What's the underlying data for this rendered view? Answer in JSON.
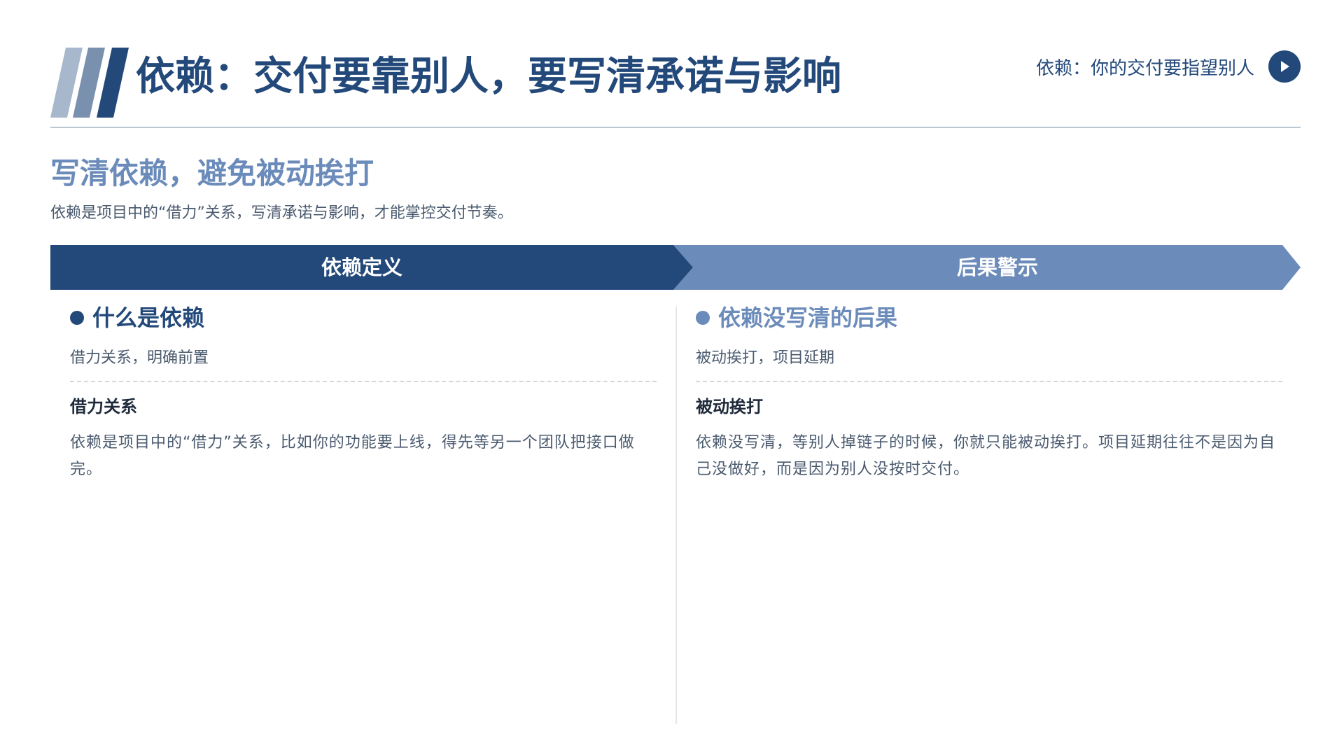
{
  "header": {
    "title": "依赖：交付要靠别人，要写清承诺与影响",
    "nav_link": "依赖：你的交付要指望别人",
    "nav_icon": "play-circle-icon"
  },
  "section": {
    "title": "写清依赖，避免被动挨打",
    "description": "依赖是项目中的“借力”关系，写清承诺与影响，才能掌控交付节奏。"
  },
  "banner": {
    "left_label": "依赖定义",
    "right_label": "后果警示"
  },
  "left_column": {
    "title": "什么是依赖",
    "subtitle": "借力关系，明确前置",
    "heading": "借力关系",
    "body": "依赖是项目中的“借力”关系，比如你的功能要上线，得先等另一个团队把接口做完。"
  },
  "right_column": {
    "title": "依赖没写清的后果",
    "subtitle": "被动挨打，项目延期",
    "heading": "被动挨打",
    "body": "依赖没写清，等别人掉链子的时候，你就只能被动挨打。项目延期往往不是因为自己没做好，而是因为别人没按时交付。"
  },
  "colors": {
    "primary": "#23497a",
    "secondary": "#6b8bba",
    "stripe_light": "#a8b8cc",
    "stripe_mid": "#7990ae",
    "rule": "#b9c8d3",
    "text_muted": "#4a5a6e"
  }
}
